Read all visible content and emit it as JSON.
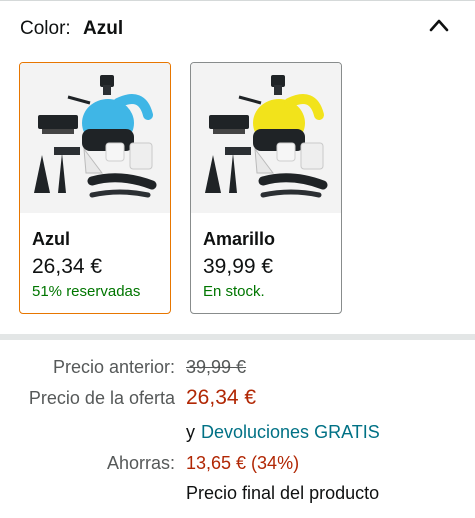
{
  "color_selector": {
    "label": "Color:",
    "selected_value": "Azul",
    "collapse_icon": "chevron-up-icon"
  },
  "swatches": [
    {
      "name": "Azul",
      "price": "26,34 €",
      "status": "51% reservadas",
      "product_color": "#3fb6e6",
      "selected": true
    },
    {
      "name": "Amarillo",
      "price": "39,99 €",
      "status": "En stock.",
      "product_color": "#f2e31b",
      "selected": false
    }
  ],
  "pricing": {
    "previous_label": "Precio anterior:",
    "previous_value": "39,99 €",
    "deal_label": "Precio de la oferta",
    "deal_value": "26,34 €",
    "returns_prefix": "y",
    "returns_link": "Devoluciones GRATIS",
    "savings_label": "Ahorras:",
    "savings_value": "13,65 € (34%)",
    "final_note": "Precio final del producto"
  },
  "colors": {
    "selected_border": "#e77600",
    "in_stock_green": "#007600",
    "deal_red": "#b12704",
    "link_teal": "#007185"
  }
}
